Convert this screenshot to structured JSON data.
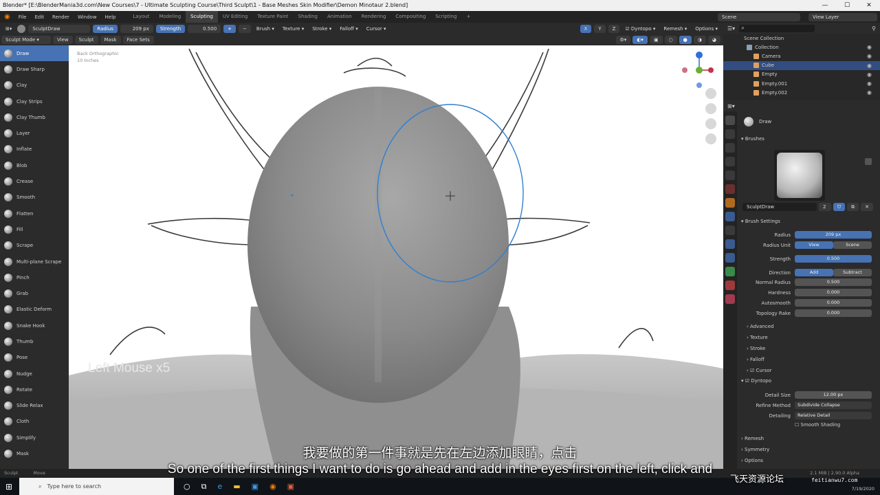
{
  "window": {
    "title": "Blender* [E:\\BlenderMania3d.com\\New Courses\\7 - Ultimate Sculpting Course\\Third Sculpt\\1 - Base Meshes Skin Modifier\\Demon Minotaur 2.blend]",
    "min": "—",
    "max": "☐",
    "close": "✕"
  },
  "menu": [
    "File",
    "Edit",
    "Render",
    "Window",
    "Help"
  ],
  "workspaces": [
    "Layout",
    "Modeling",
    "Sculpting",
    "UV Editing",
    "Texture Paint",
    "Shading",
    "Animation",
    "Rendering",
    "Compositing",
    "Scripting"
  ],
  "active_workspace": "Sculpting",
  "scene_label": "Scene",
  "view_layer_label": "View Layer",
  "tool_header": {
    "brush_name": "SculptDraw",
    "radius_label": "Radius",
    "radius_value": "209 px",
    "strength_label": "Strength",
    "strength_value": "0.500",
    "plus": "+",
    "minus": "−",
    "menus": [
      "Brush",
      "Texture",
      "Stroke",
      "Falloff",
      "Cursor"
    ],
    "dyntopo": "Dyntopo",
    "remesh": "Remesh",
    "options": "Options",
    "xyz": [
      "X",
      "Y",
      "Z"
    ]
  },
  "viewport_header": {
    "mode": "Sculpt Mode",
    "menus": [
      "View",
      "Sculpt",
      "Mask",
      "Face Sets"
    ]
  },
  "viewport_overlay": {
    "view_name": "Back Orthographic",
    "units": "10 Inches",
    "keypress": "Left Mouse x5"
  },
  "tools": [
    "Draw",
    "Draw Sharp",
    "Clay",
    "Clay Strips",
    "Clay Thumb",
    "Layer",
    "Inflate",
    "Blob",
    "Crease",
    "Smooth",
    "Flatten",
    "Fill",
    "Scrape",
    "Multi-plane Scrape",
    "Pinch",
    "Grab",
    "Elastic Deform",
    "Snake Hook",
    "Thumb",
    "Pose",
    "Nudge",
    "Rotate",
    "Slide Relax",
    "Cloth",
    "Simplify",
    "Mask"
  ],
  "active_tool": "Draw",
  "outliner": {
    "title": "Scene Collection",
    "items": [
      {
        "name": "Collection",
        "level": 1,
        "selected": false,
        "color": "#8aa0b8"
      },
      {
        "name": "Camera",
        "level": 2,
        "selected": false,
        "color": "#e0a060"
      },
      {
        "name": "Cube",
        "level": 2,
        "selected": true,
        "color": "#e0a060"
      },
      {
        "name": "Empty",
        "level": 2,
        "selected": false,
        "color": "#e0a060"
      },
      {
        "name": "Empty.001",
        "level": 2,
        "selected": false,
        "color": "#e0a060"
      },
      {
        "name": "Empty.002",
        "level": 2,
        "selected": false,
        "color": "#e0a060"
      }
    ]
  },
  "properties": {
    "tool_name": "Draw",
    "brushes_label": "Brushes",
    "brush_name": "SculptDraw",
    "brush_users": "2",
    "brush_settings_label": "Brush Settings",
    "radius": {
      "label": "Radius",
      "value": "209 px"
    },
    "radius_unit": {
      "label": "Radius Unit",
      "view": "View",
      "scene": "Scene"
    },
    "strength": {
      "label": "Strength",
      "value": "0.500"
    },
    "direction": {
      "label": "Direction",
      "add": "Add",
      "subtract": "Subtract"
    },
    "normal_radius": {
      "label": "Normal Radius",
      "value": "0.500"
    },
    "hardness": {
      "label": "Hardness",
      "value": "0.000"
    },
    "autosmooth": {
      "label": "Autosmooth",
      "value": "0.000"
    },
    "topology_rake": {
      "label": "Topology Rake",
      "value": "0.000"
    },
    "sections": [
      "Advanced",
      "Texture",
      "Stroke",
      "Falloff",
      "Cursor"
    ],
    "dyntopo": {
      "label": "Dyntopo",
      "detail_size": {
        "label": "Detail Size",
        "value": "12.00 px"
      },
      "refine_method": {
        "label": "Refine Method",
        "value": "Subdivide Collapse"
      },
      "detailing": {
        "label": "Detailing",
        "value": "Relative Detail"
      },
      "smooth_shading": "Smooth Shading"
    },
    "more_sections": [
      "Remesh",
      "Symmetry",
      "Options"
    ]
  },
  "status_bar": {
    "left": "Sculpt",
    "middle": "Move",
    "right": "2.1 MiB | 2.90.0 Alpha"
  },
  "taskbar": {
    "search_placeholder": "Type here to search",
    "time": "7/19/2020"
  },
  "subtitles": {
    "chinese": "我要做的第一件事就是先在左边添加眼睛，点击",
    "english": "So one of the first things I want to do is go ahead and add in the eyes first on the left, click and"
  },
  "watermark": {
    "main": "飞天资源论坛",
    "url": "feitianwu7.com"
  },
  "colors": {
    "accent": "#4772b3",
    "panel": "#2b2b2b",
    "header": "#232323",
    "viewport_bg": "#ffffff",
    "brush_circle": "#2f7fd0"
  }
}
